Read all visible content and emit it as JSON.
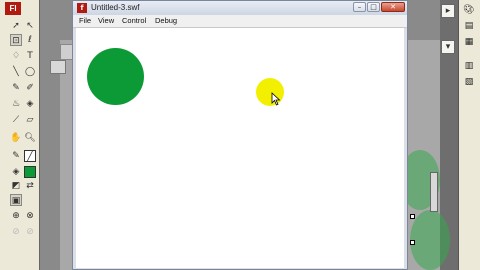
{
  "tools_panel": {
    "app_logo": "Fl"
  },
  "player": {
    "title": "Untitled-3.swf",
    "app_icon": "f",
    "window_controls": [
      "minimize",
      "maximize",
      "close"
    ],
    "menu": [
      "File",
      "View",
      "Control",
      "Debug"
    ]
  },
  "stage": {
    "shapes": [
      {
        "kind": "circle",
        "color": "#0c9a36"
      },
      {
        "kind": "circle",
        "color": "#f2f000"
      }
    ]
  },
  "colors": {
    "stage_background": "#ffffff",
    "green_circle": "#0c9a36",
    "yellow_circle": "#f2f000"
  }
}
